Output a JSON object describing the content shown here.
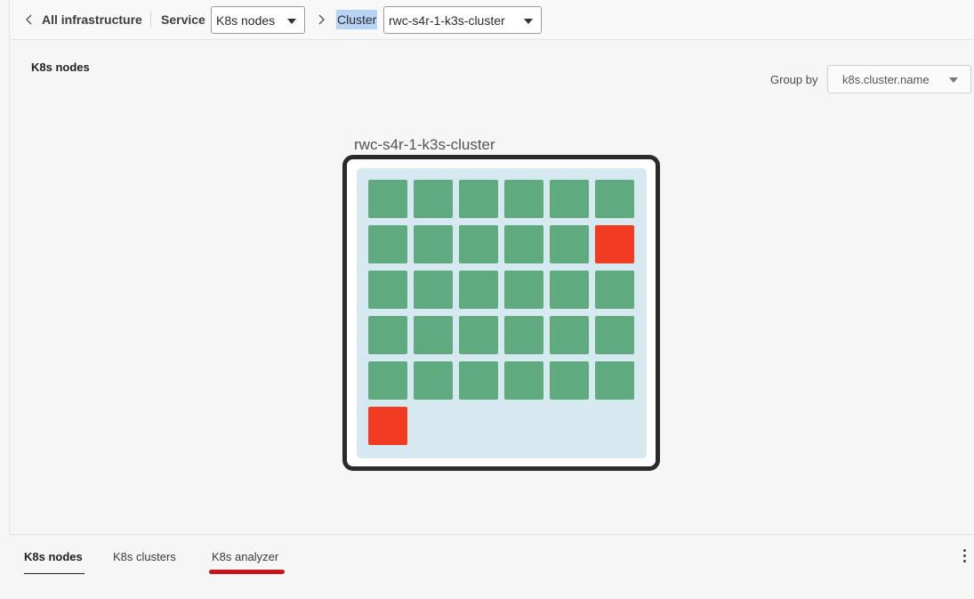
{
  "breadcrumb": {
    "back_label": "All infrastructure",
    "service_label": "Service",
    "service_value": "K8s nodes",
    "cluster_label": "Cluster",
    "cluster_value": "rwc-s4r-1-k3s-cluster"
  },
  "panel": {
    "title": "K8s nodes",
    "group_by_label": "Group by",
    "group_by_value": "k8s.cluster.name"
  },
  "cluster": {
    "name": "rwc-s4r-1-k3s-cluster",
    "node_status": [
      "ok",
      "ok",
      "ok",
      "ok",
      "ok",
      "ok",
      "ok",
      "ok",
      "ok",
      "ok",
      "ok",
      "bad",
      "ok",
      "ok",
      "ok",
      "ok",
      "ok",
      "ok",
      "ok",
      "ok",
      "ok",
      "ok",
      "ok",
      "ok",
      "ok",
      "ok",
      "ok",
      "ok",
      "ok",
      "ok",
      "bad"
    ],
    "colors": {
      "ok": "#5fab7f",
      "bad": "#f23b23"
    }
  },
  "tabs": [
    {
      "label": "K8s nodes",
      "active": true
    },
    {
      "label": "K8s clusters",
      "active": false
    },
    {
      "label": "K8s analyzer",
      "active": false
    }
  ],
  "icons": {
    "back": "chevron-left-icon",
    "separator": "chevron-right-icon",
    "more": "kebab-icon"
  }
}
